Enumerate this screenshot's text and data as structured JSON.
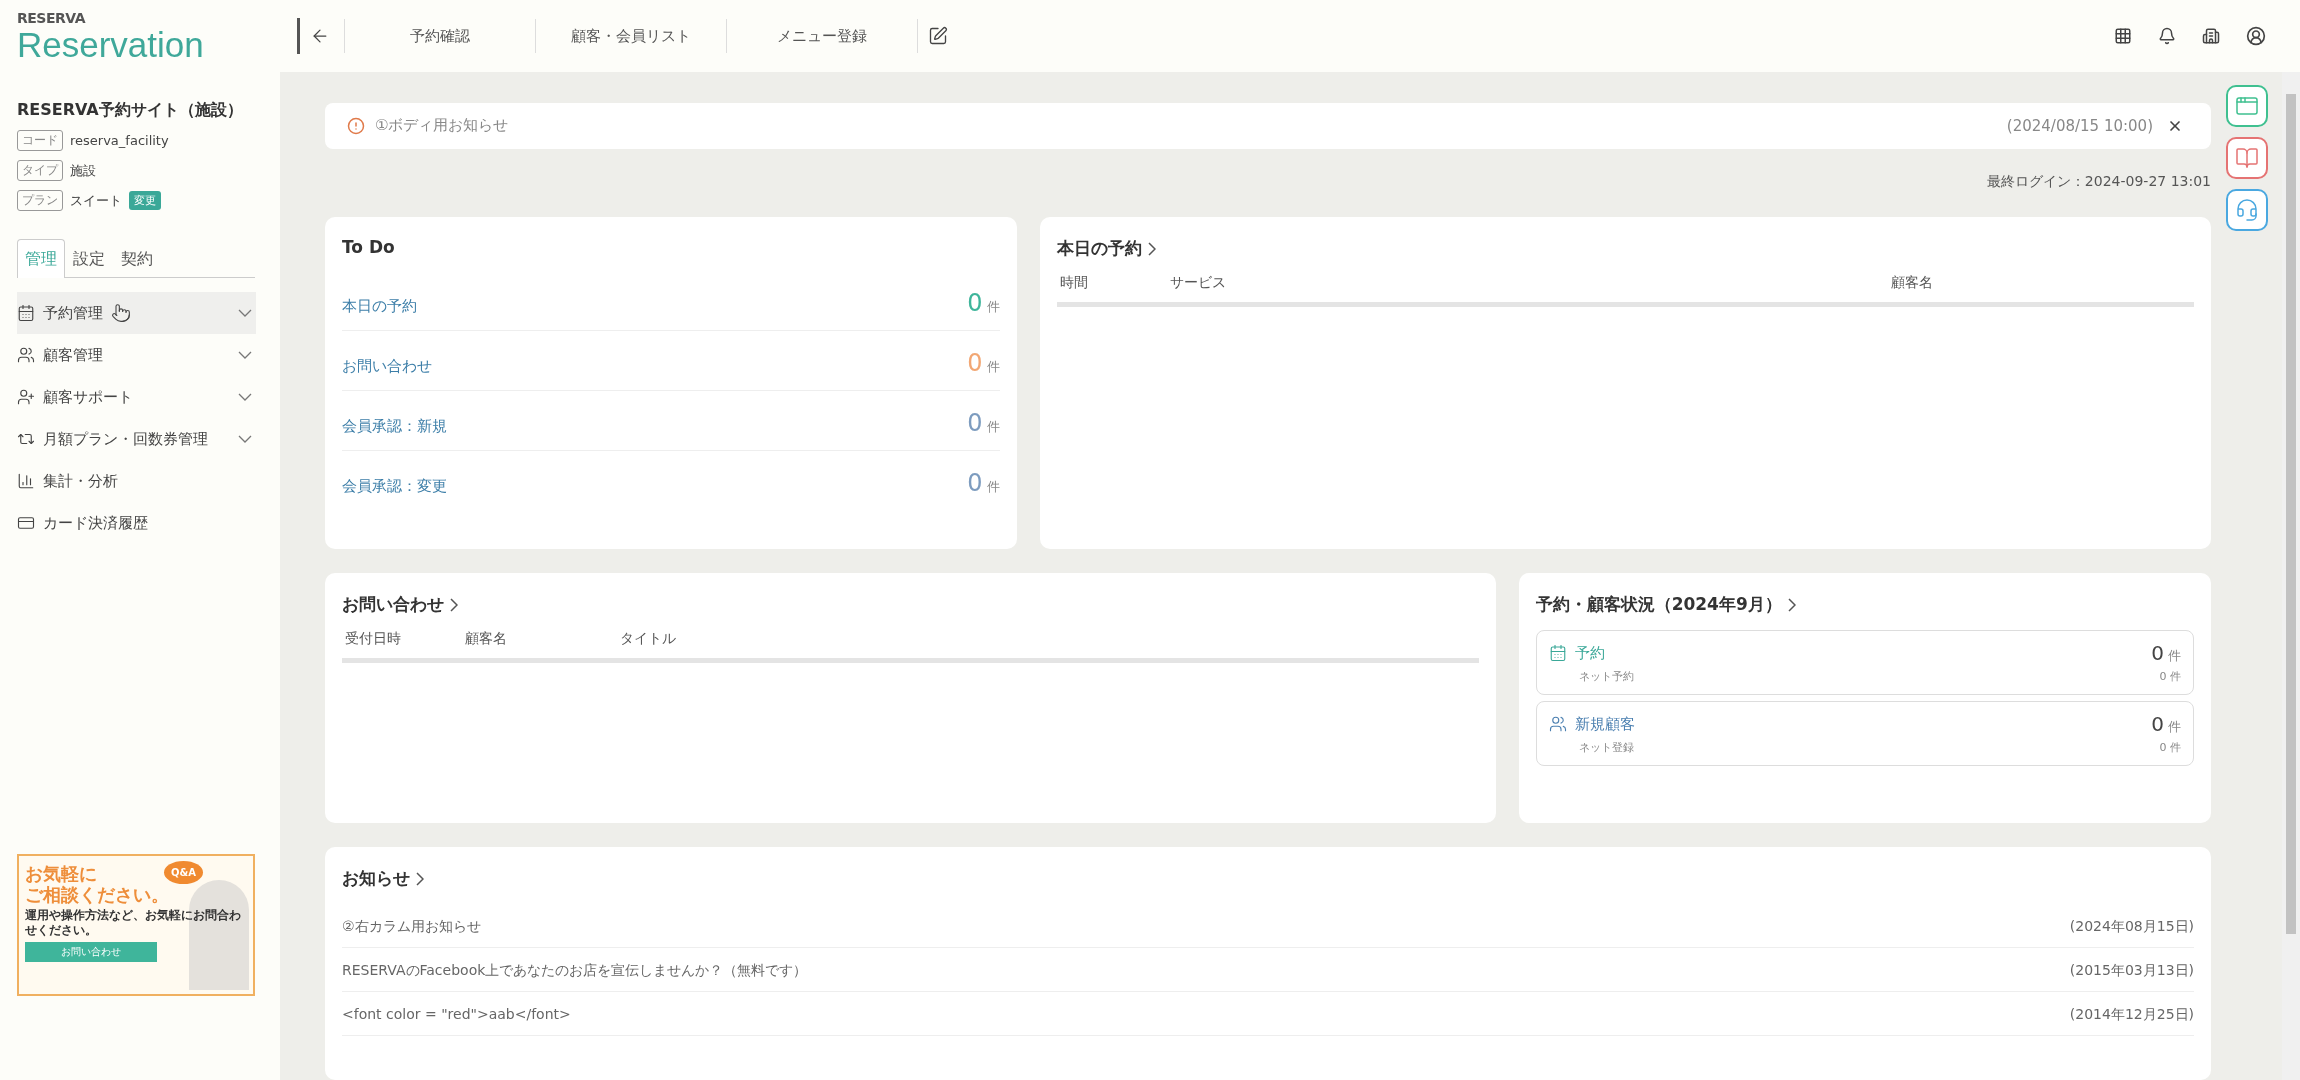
{
  "logo": {
    "brand": "RESERVA",
    "name": "Reservation"
  },
  "site": {
    "title": "RESERVA予約サイト（施設）",
    "info": [
      {
        "label": "コード",
        "value": "reserva_facility"
      },
      {
        "label": "タイプ",
        "value": "施設"
      },
      {
        "label": "プラン",
        "value": "スイート",
        "badge": "変更"
      }
    ]
  },
  "tabs": [
    {
      "label": "管理",
      "selected": true
    },
    {
      "label": "設定",
      "selected": false
    },
    {
      "label": "契約",
      "selected": false
    }
  ],
  "nav": [
    {
      "label": "予約管理",
      "kind": "group",
      "highlighted": true
    },
    {
      "label": "顧客管理",
      "kind": "group",
      "highlighted": false
    },
    {
      "label": "顧客サポート",
      "kind": "group",
      "highlighted": false
    },
    {
      "label": "月額プラン・回数券管理",
      "kind": "group",
      "highlighted": false
    },
    {
      "label": "集計・分析",
      "kind": "link",
      "highlighted": false
    },
    {
      "label": "カード決済履歴",
      "kind": "link",
      "highlighted": false
    }
  ],
  "banner": {
    "headline": [
      "お気軽に",
      "ご相談ください。"
    ],
    "bubble": "Q&A",
    "body": "運用や操作方法など、お気軽にお問合わせください。",
    "button": "お問い合わせ"
  },
  "header": {
    "links": [
      "予約確認",
      "顧客・会員リスト",
      "メニュー登録"
    ]
  },
  "notice": {
    "text": "①ボディ用お知らせ",
    "date": "(2024/08/15 10:00)"
  },
  "last_login": "最終ログイン：2024-09-27 13:01",
  "todo": {
    "title": "To Do",
    "items": [
      {
        "label": "本日の予約",
        "count": "0",
        "unit": "件",
        "color": "#3fb59b"
      },
      {
        "label": "お問い合わせ",
        "count": "0",
        "unit": "件",
        "color": "#f2a774"
      },
      {
        "label": "会員承認：新規",
        "count": "0",
        "unit": "件",
        "color": "#7d9cbf"
      },
      {
        "label": "会員承認：変更",
        "count": "0",
        "unit": "件",
        "color": "#7d9cbf"
      }
    ]
  },
  "today": {
    "title": "本日の予約",
    "columns": [
      "時間",
      "サービス",
      "顧客名"
    ]
  },
  "inquiries": {
    "title": "お問い合わせ",
    "columns": [
      "受付日時",
      "顧客名",
      "タイトル"
    ]
  },
  "status": {
    "title": "予約・顧客状況（2024年9月）",
    "items": [
      {
        "label": "予約",
        "count": "0",
        "unit": "件",
        "sub_label": "ネット予約",
        "sub_count": "0",
        "sub_unit": "件"
      },
      {
        "label": "新規顧客",
        "count": "0",
        "unit": "件",
        "sub_label": "ネット登録",
        "sub_count": "0",
        "sub_unit": "件"
      }
    ]
  },
  "news": {
    "title": "お知らせ",
    "items": [
      {
        "text": "②右カラム用お知らせ",
        "date": "(2024年08月15日)"
      },
      {
        "text": "RESERVAのFacebook上であなたのお店を宣伝しませんか？（無料です）",
        "date": "(2015年03月13日)"
      },
      {
        "text": "<font color = \"red\">aab</font>",
        "date": "(2014年12月25日)"
      }
    ]
  }
}
